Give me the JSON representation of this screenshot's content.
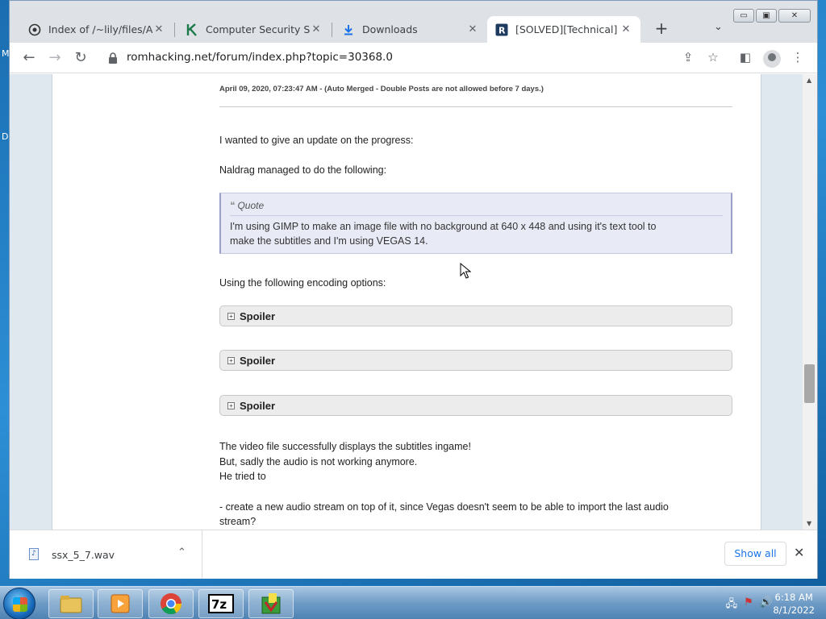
{
  "desktop": {
    "left_letters": [
      "M",
      "D"
    ]
  },
  "window": {
    "controls": {
      "minimize": "▭",
      "restore": "▣",
      "close": "✕"
    }
  },
  "tabs": [
    {
      "title": "Index of /~lily/files/Arch",
      "icon": "server-icon",
      "active": false
    },
    {
      "title": "Computer Security Softw",
      "icon": "k-logo-icon",
      "active": false
    },
    {
      "title": "Downloads",
      "icon": "download-icon",
      "active": false
    },
    {
      "title": "[SOLVED][Technical] [PS",
      "icon": "romhacking-icon",
      "active": true
    }
  ],
  "tabstrip": {
    "new_tab": "+",
    "tab_search": "⌄",
    "close_glyph": "✕"
  },
  "toolbar": {
    "url": "romhacking.net/forum/index.php?topic=30368.0",
    "back": "←",
    "forward": "→",
    "reload": "↻",
    "share": "⇪",
    "bookmark": "☆",
    "sidepanel": "◧",
    "menu": "⋮"
  },
  "post": {
    "meta": "April 09, 2020, 07:23:47 AM - (Auto Merged - Double Posts are not allowed before 7 days.)",
    "p1": "I wanted to give an update on the progress:",
    "p2": "Naldrag managed to do the following:",
    "quote": {
      "label": "Quote",
      "line1": "I'm using GIMP to make an image file with no background at 640 x 448 and using it's text tool to",
      "line2": "make the subtitles and I'm using VEGAS 14."
    },
    "p3": "Using the following encoding options:",
    "spoilers": [
      "Spoiler",
      "Spoiler",
      "Spoiler"
    ],
    "p4a": "The video file successfully displays the subtitles ingame!",
    "p4b": "But, sadly the audio is not working anymore.",
    "p4c": "He tried to",
    "p5a": "- create a new audio stream on top of it, since Vegas doesn't seem to be able to import the last audio",
    "p5b": "stream?"
  },
  "downloads": {
    "file_name": "ssx_5_7.wav",
    "show_all": "Show all"
  },
  "taskbar": {
    "apps": [
      "explorer",
      "media-player",
      "chrome",
      "7zip",
      "game-app"
    ],
    "time": "6:18 AM",
    "date": "8/1/2022"
  }
}
